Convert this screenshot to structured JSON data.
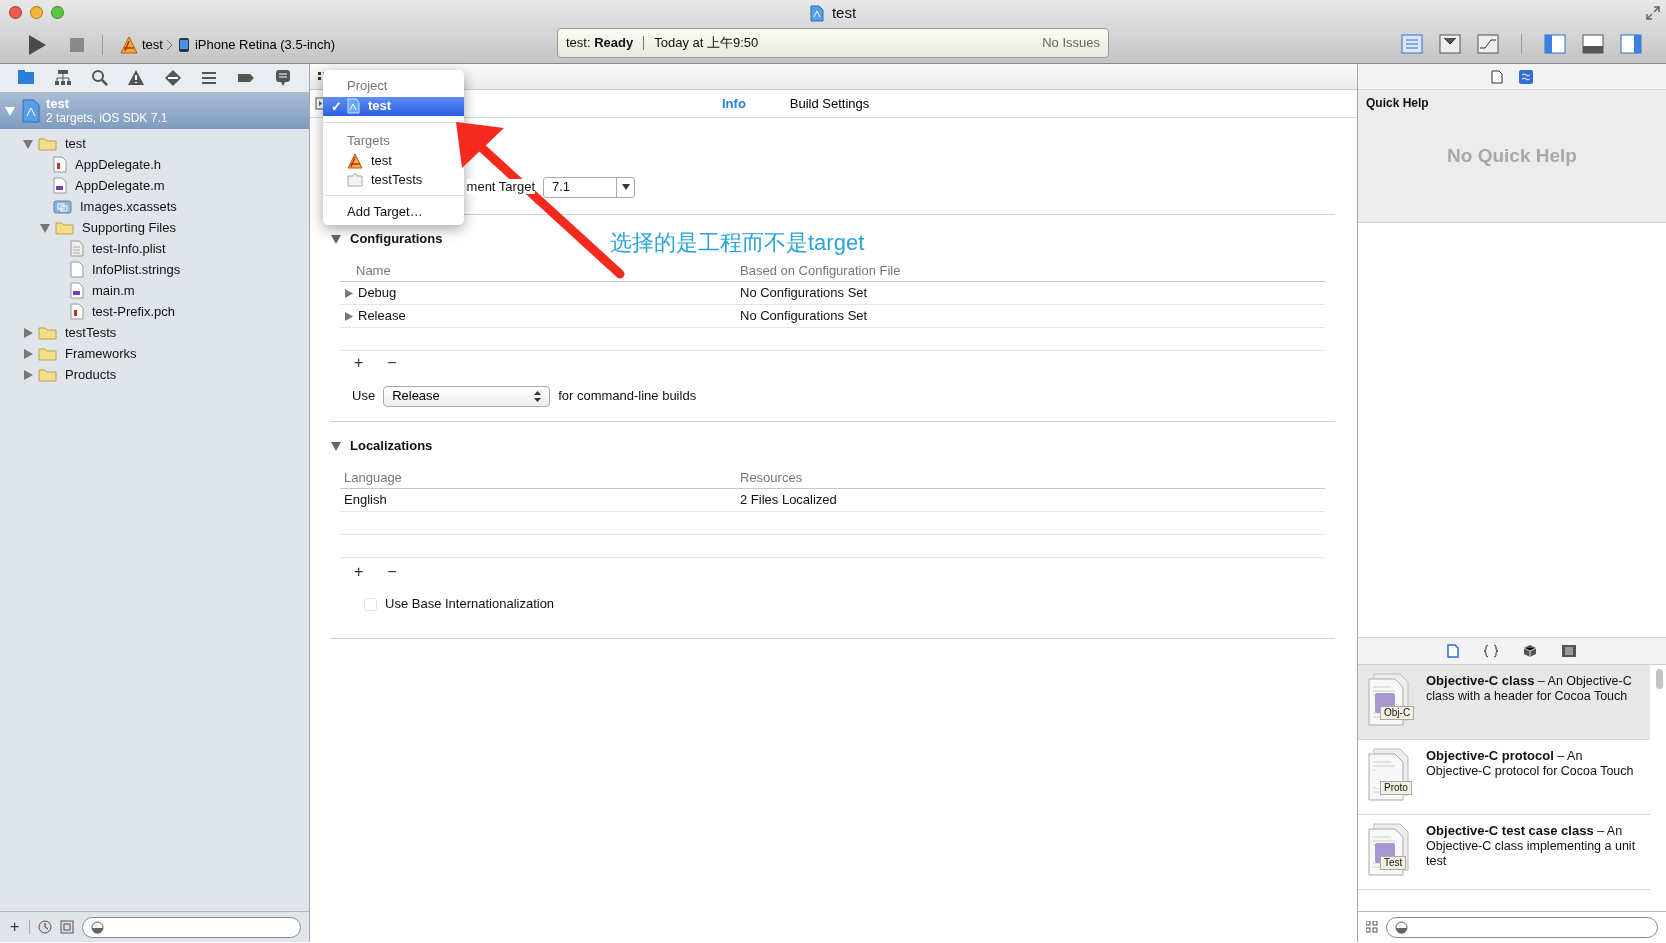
{
  "window": {
    "title": "test"
  },
  "toolbar": {
    "scheme": "test",
    "device": "iPhone Retina (3.5-inch)",
    "status": {
      "project": "test:",
      "state": "Ready",
      "time": "Today at 上午9:50",
      "issues": "No Issues"
    }
  },
  "navigator": {
    "project": {
      "name": "test",
      "subtitle": "2 targets, iOS SDK 7.1",
      "selected": true,
      "expanded": true
    },
    "tree": [
      {
        "name": "test",
        "kind": "folder",
        "expanded": true,
        "children": [
          {
            "name": "AppDelegate.h",
            "kind": "header"
          },
          {
            "name": "AppDelegate.m",
            "kind": "source"
          },
          {
            "name": "Images.xcassets",
            "kind": "assets"
          },
          {
            "name": "Supporting Files",
            "kind": "folder",
            "expanded": true,
            "children": [
              {
                "name": "test-Info.plist",
                "kind": "plist"
              },
              {
                "name": "InfoPlist.strings",
                "kind": "strings"
              },
              {
                "name": "main.m",
                "kind": "source"
              },
              {
                "name": "test-Prefix.pch",
                "kind": "header"
              }
            ]
          }
        ]
      },
      {
        "name": "testTests",
        "kind": "folder",
        "expanded": false
      },
      {
        "name": "Frameworks",
        "kind": "folder",
        "expanded": false
      },
      {
        "name": "Products",
        "kind": "folder",
        "expanded": false
      }
    ],
    "add": "+"
  },
  "popup_menu": {
    "sections": [
      {
        "heading": "Project",
        "items": [
          {
            "label": "test",
            "kind": "project",
            "selected": true
          }
        ]
      },
      {
        "heading": "Targets",
        "items": [
          {
            "label": "test",
            "kind": "app",
            "selected": false
          },
          {
            "label": "testTests",
            "kind": "bundle",
            "selected": false
          }
        ]
      }
    ],
    "check": "✓",
    "action": "Add Target…"
  },
  "editor": {
    "tabs": [
      {
        "label": "Info",
        "selected": true
      },
      {
        "label": "Build Settings",
        "selected": false
      }
    ],
    "deployment": {
      "label": "ment Target",
      "value": "7.1"
    },
    "configurations": {
      "title": "Configurations",
      "expanded": true,
      "columns": [
        "Name",
        "Based on Configuration File"
      ],
      "rows": [
        {
          "name": "Debug",
          "file": "No Configurations Set"
        },
        {
          "name": "Release",
          "file": "No Configurations Set"
        }
      ],
      "add": "+",
      "remove": "−",
      "use_label": "Use",
      "use_value": "Release",
      "use_suffix": "for command-line builds"
    },
    "localizations": {
      "title": "Localizations",
      "expanded": true,
      "columns": [
        "Language",
        "Resources"
      ],
      "rows": [
        {
          "language": "English",
          "resources": "2 Files Localized"
        }
      ],
      "add": "+",
      "remove": "−",
      "checkbox": {
        "label": "Use Base Internationalization",
        "checked": false
      }
    }
  },
  "annotation": {
    "text": "选择的是工程而不是target"
  },
  "inspector": {
    "title": "Quick Help",
    "empty": "No Quick Help",
    "library": [
      {
        "title": "Objective-C class",
        "description": "– An Objective-C class with a header for Cocoa Touch",
        "badge": "Obj-C",
        "selected": true
      },
      {
        "title": "Objective-C protocol",
        "description": "– An Objective-C protocol for Cocoa Touch",
        "badge": "Proto",
        "selected": false
      },
      {
        "title": "Objective-C test case class",
        "description": "– An Objective-C class implementing a unit test",
        "badge": "Test",
        "selected": false
      }
    ]
  }
}
